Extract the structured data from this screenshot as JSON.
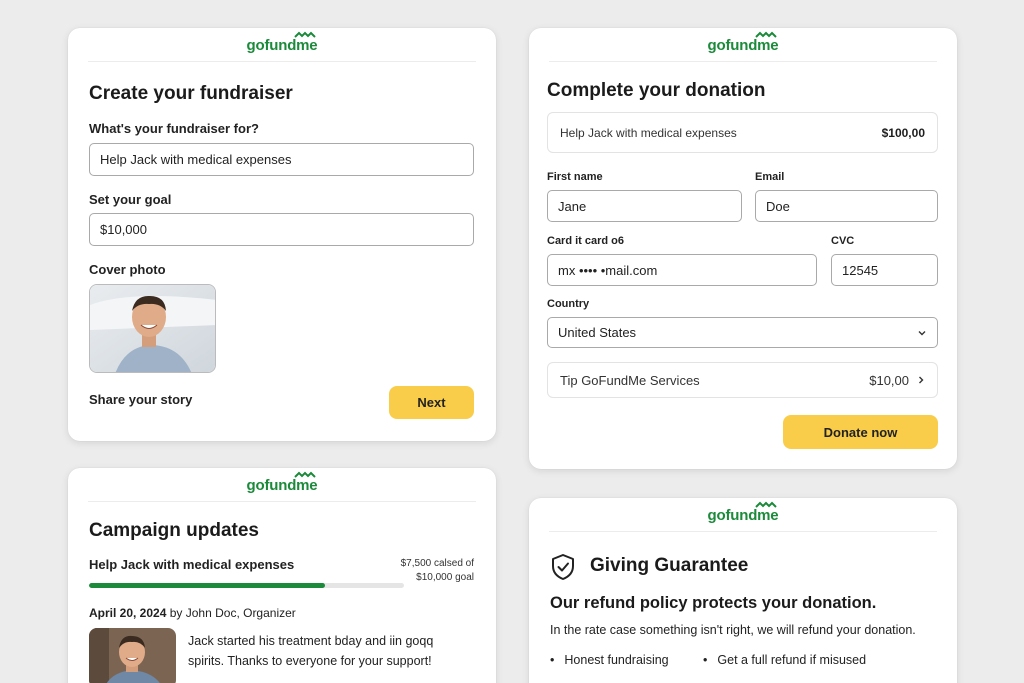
{
  "brand": {
    "logo_text": "gofundme",
    "color": "#1b8a3a"
  },
  "accent": {
    "button_yellow": "#f9cd4a",
    "progress_green": "#1b8a3a"
  },
  "create_card": {
    "title": "Create your fundraiser",
    "purpose_label": "What's your fundraiser for?",
    "purpose_value": "Help Jack with medical expenses",
    "goal_label": "Set your goal",
    "goal_value": "$10,000",
    "photo_label": "Cover photo",
    "story_label": "Share your story",
    "next_label": "Next"
  },
  "donation_card": {
    "title": "Complete your donation",
    "summary_name": "Help Jack with medical expenses",
    "summary_amount": "$100,00",
    "first_name_label": "First name",
    "first_name_value": "Jane",
    "email_label": "Email",
    "email_value": "Doe",
    "card_label": "Card it card o6",
    "card_value": "mx •••• •mail.com",
    "cvc_label": "CVC",
    "cvc_value": "12545",
    "country_label": "Country",
    "country_value": "United States",
    "tip_label": "Tip GoFundMe Services",
    "tip_amount": "$10,00",
    "donate_label": "Donate now"
  },
  "updates_card": {
    "title": "Campaign updates",
    "campaign_name": "Help Jack with medical expenses",
    "raised_line1": "$7,500 calsed of",
    "raised_line2": "$10,000 goal",
    "progress_fraction": 0.75,
    "post_date": "April 20, 2024",
    "post_author": "by John Doc, Organizer",
    "post_line1": "Jack started his treatment bday and iin goqq",
    "post_line2": "spirits. Thanks to everyone for your support!"
  },
  "guarantee_card": {
    "title": "Giving Guarantee",
    "heading": "Our refund policy protects your donation.",
    "body": "In the rate case something isn't right, we will refund your donation.",
    "bullets": [
      "Honest fundraising",
      "Get a full refund if misused"
    ]
  },
  "icons": {
    "chevron_down": "chevron-down-icon",
    "chevron_right": "chevron-right-icon",
    "shield": "shield-check-icon"
  }
}
